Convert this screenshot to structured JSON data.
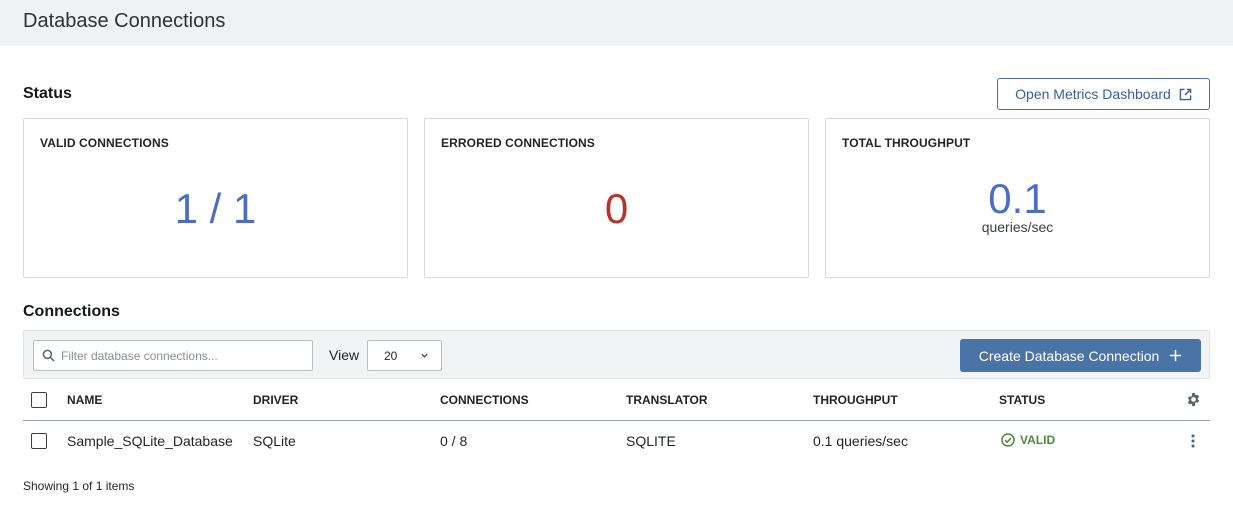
{
  "header": {
    "title": "Database Connections"
  },
  "status": {
    "title": "Status",
    "metrics_button_label": "Open Metrics Dashboard",
    "cards": [
      {
        "label": "VALID CONNECTIONS",
        "value": "1 / 1",
        "color": "#4b6ec4"
      },
      {
        "label": "ERRORED CONNECTIONS",
        "value": "0",
        "color": "#b5352b"
      },
      {
        "label": "TOTAL THROUGHPUT",
        "value": "0.1",
        "unit": "queries/sec",
        "color": "#4b6ec4"
      }
    ]
  },
  "connections": {
    "title": "Connections",
    "filter_placeholder": "Filter database connections...",
    "view_label": "View",
    "view_value": "20",
    "create_button_label": "Create Database Connection",
    "columns": [
      "NAME",
      "DRIVER",
      "CONNECTIONS",
      "TRANSLATOR",
      "THROUGHPUT",
      "STATUS"
    ],
    "rows": [
      {
        "name": "Sample_SQLite_Database",
        "driver": "SQLite",
        "connections": "0 / 8",
        "translator": "SQLITE",
        "throughput": "0.1 queries/sec",
        "status": "VALID"
      }
    ],
    "footer": "Showing 1 of 1 items"
  },
  "colors": {
    "accent": "#4a74a8",
    "valid": "#4f8a3c",
    "error": "#b5352b",
    "metric": "#4b6ec4"
  }
}
